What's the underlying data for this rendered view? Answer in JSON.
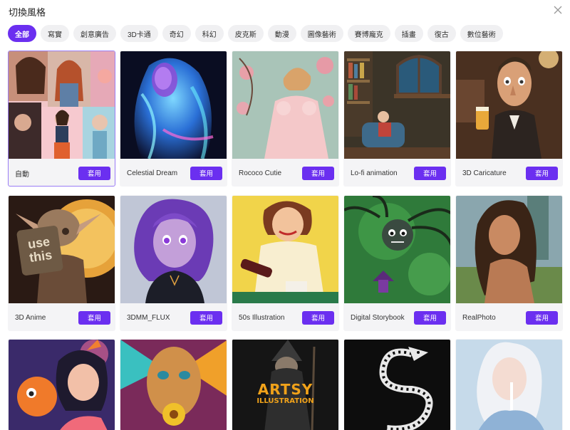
{
  "header": {
    "title": "切換風格"
  },
  "tags": [
    "全部",
    "寫實",
    "創意廣告",
    "3D卡通",
    "奇幻",
    "科幻",
    "皮克斯",
    "動漫",
    "圖像藝術",
    "賽博龐克",
    "插畫",
    "復古",
    "數位藝術"
  ],
  "apply_label": "套用",
  "cards": [
    {
      "name": "自動",
      "icon": "collage-thumbnail"
    },
    {
      "name": "Celestial Dream",
      "icon": "glowing-figure-thumbnail"
    },
    {
      "name": "Rococo Cutie",
      "icon": "rococo-lady-thumbnail"
    },
    {
      "name": "Lo-fi animation",
      "icon": "lofi-room-thumbnail"
    },
    {
      "name": "3D Caricature",
      "icon": "caricature-man-thumbnail"
    },
    {
      "name": "3D Anime",
      "icon": "anime-elf-thumbnail",
      "sign_top": "use",
      "sign_bottom": "this"
    },
    {
      "name": "3DMM_FLUX",
      "icon": "purple-hair-girl-thumbnail"
    },
    {
      "name": "50s Illustration",
      "icon": "retro-woman-thumbnail"
    },
    {
      "name": "Digital Storybook",
      "icon": "forest-creature-thumbnail"
    },
    {
      "name": "RealPhoto",
      "icon": "portrait-photo-thumbnail"
    },
    {
      "icon": "cartoon-girl-thumbnail"
    },
    {
      "icon": "colorful-face-thumbnail"
    },
    {
      "icon": "wizard-thumbnail",
      "title_top": "ARTSY",
      "title_bottom": "ILLUSTRATION"
    },
    {
      "icon": "dragon-thumbnail"
    },
    {
      "icon": "white-hair-girl-thumbnail"
    }
  ]
}
